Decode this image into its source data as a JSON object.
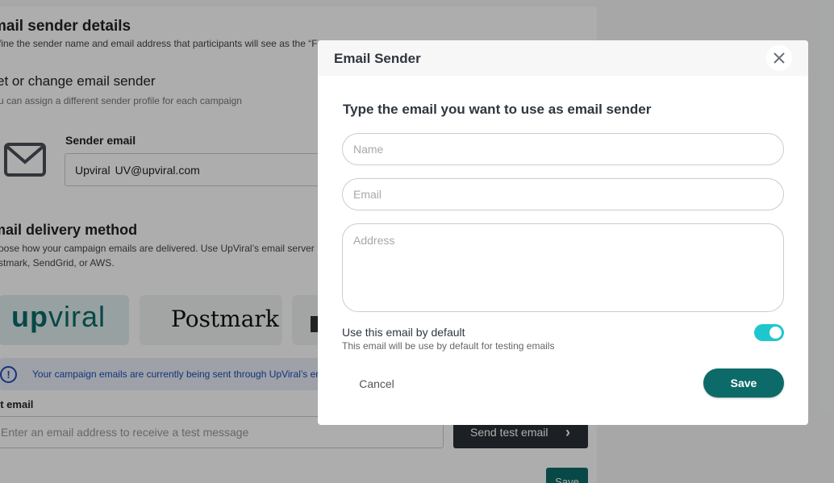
{
  "background": {
    "section_title": "mail sender details",
    "section_desc": "fine the sender name and email address that participants will see as the “F",
    "change_title": "et or change email sender",
    "change_desc": "u can assign a different sender profile for each campaign",
    "sender_label": "Sender email",
    "sender_name": "Upviral",
    "sender_email": "UV@upviral.com",
    "delivery_title": "mail delivery method",
    "delivery_desc_1": "oose how your campaign emails are delivered. Use UpViral’s email server",
    "delivery_desc_2": "stmark, SendGrid, or AWS.",
    "providers": [
      {
        "logo_main": "up",
        "logo_rest": "viral"
      },
      {
        "logo": "Postmark"
      }
    ],
    "info_text": "Your campaign emails are currently being sent through UpViral’s er",
    "test_label": "st email",
    "test_placeholder": "Enter an email address to receive a test message",
    "send_test_label": "Send test email",
    "save_label": "Save"
  },
  "modal": {
    "title": "Email Sender",
    "heading": "Type the email you want to use as email sender",
    "name_placeholder": "Name",
    "email_placeholder": "Email",
    "address_placeholder": "Address",
    "default_label": "Use this email by default",
    "default_sub": "This email will be use by default for testing emails",
    "default_enabled": true,
    "cancel_label": "Cancel",
    "save_label": "Save"
  },
  "colors": {
    "primary": "#0c6b69",
    "toggle_on": "#1ec7cd",
    "info": "#1d4db8"
  }
}
